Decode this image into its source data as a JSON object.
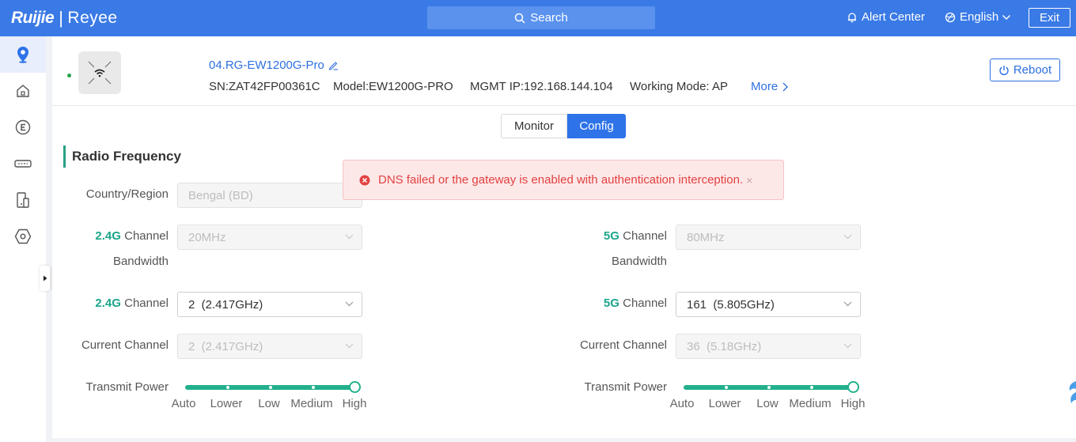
{
  "brand": {
    "ruijie": "Ruijie",
    "separator": "|",
    "reyee": "Reyee"
  },
  "topbar": {
    "search_label": "Search",
    "alert_center": "Alert Center",
    "language": "English",
    "exit": "Exit"
  },
  "sidebar": {
    "items": [
      {
        "icon": "location-pin-icon",
        "active": true
      },
      {
        "icon": "home-icon",
        "active": false
      },
      {
        "icon": "eg-circle-icon",
        "active": false
      },
      {
        "icon": "switch-device-icon",
        "active": false
      },
      {
        "icon": "ap-device-icon",
        "active": false
      },
      {
        "icon": "hexagon-settings-icon",
        "active": false
      }
    ]
  },
  "device": {
    "name": "04.RG-EW1200G-Pro",
    "sn": "SN:ZAT42FP00361C",
    "model": "Model:EW1200G-PRO",
    "mgmt_ip": "MGMT IP:192.168.144.104",
    "working_mode": "Working Mode: AP",
    "more": "More",
    "reboot": "Reboot",
    "status_color": "#27a34b"
  },
  "tabs": {
    "monitor": "Monitor",
    "config": "Config"
  },
  "section": {
    "title": "Radio Frequency"
  },
  "alert": {
    "message": "DNS failed or the gateway is enabled with authentication interception.",
    "close": "×"
  },
  "form": {
    "country_label": "Country/Region",
    "country_value": "Bengal (BD)",
    "band24": "2.4G",
    "band5": "5G",
    "channel_word": "Channel",
    "bandwidth_word": "Bandwidth",
    "bw24_value": "20MHz",
    "bw5_value": "80MHz",
    "ch24_value": "2  (2.417GHz)",
    "ch5_value": "161  (5.805GHz)",
    "current_channel_label": "Current Channel",
    "cur24_value": "2  (2.417GHz)",
    "cur5_value": "36  (5.18GHz)",
    "transmit_power_label": "Transmit Power",
    "power_levels": [
      "Auto",
      "Lower",
      "Low",
      "Medium",
      "High"
    ],
    "power24_level": "High",
    "power5_level": "High"
  },
  "colors": {
    "topbar": "#3a7ae6",
    "accent_blue": "#2e73e8",
    "accent_green": "#22b08c",
    "error_red": "#e24141"
  }
}
